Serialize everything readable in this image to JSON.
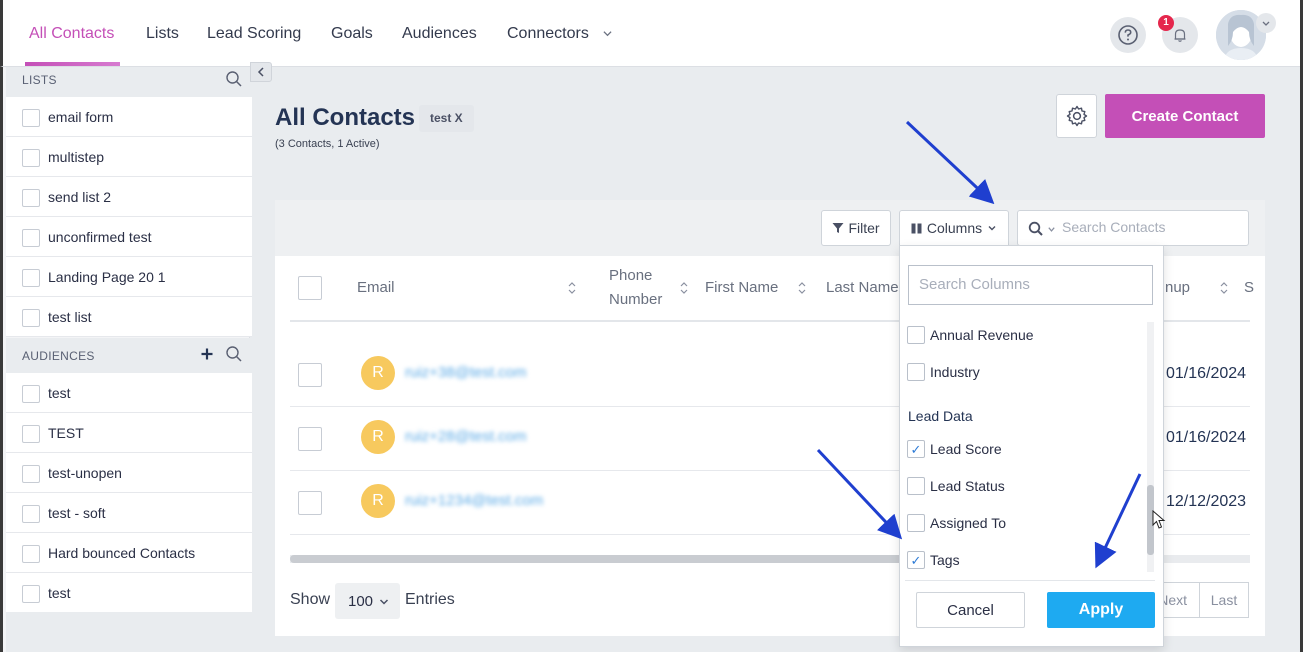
{
  "colors": {
    "accent": "#c44fb7",
    "apply": "#1eaaf1",
    "avatar": "#f7c95e",
    "badge": "#e5274d",
    "arrow": "#1f3fcf",
    "link": "#5aa9e6"
  },
  "nav": {
    "items": [
      "All Contacts",
      "Lists",
      "Lead Scoring",
      "Goals",
      "Audiences",
      "Connectors"
    ],
    "active": "All Contacts",
    "notification_count": "1"
  },
  "sidebar": {
    "lists_heading": "LISTS",
    "lists": [
      "email form",
      "multistep",
      "send list 2",
      "unconfirmed test",
      "Landing Page 20 1",
      "test list"
    ],
    "audiences_heading": "AUDIENCES",
    "audiences": [
      "test",
      "TEST",
      "test-unopen",
      "test - soft",
      "Hard bounced Contacts",
      "test"
    ]
  },
  "page": {
    "title": "All Contacts",
    "filter_chip": "test X",
    "subtitle": "(3 Contacts, 1 Active)",
    "create_label": "Create Contact"
  },
  "toolbar": {
    "filter_label": "Filter",
    "columns_label": "Columns",
    "search_placeholder": "Search Contacts"
  },
  "table": {
    "columns": [
      "Email",
      "Phone",
      "Number",
      "First Name",
      "Last Name",
      "nup",
      "S"
    ],
    "rows": [
      {
        "initial": "R",
        "email": "ruiz+38@test.com",
        "date": "01/16/2024"
      },
      {
        "initial": "R",
        "email": "ruiz+28@test.com",
        "date": "01/16/2024"
      },
      {
        "initial": "R",
        "email": "ruiz+1234@test.com",
        "date": "12/12/2023"
      }
    ]
  },
  "footer": {
    "show_label": "Show",
    "entries_value": "100",
    "entries_label": "Entries",
    "next_label": "Next",
    "last_label": "Last"
  },
  "columns_dropdown": {
    "search_placeholder": "Search Columns",
    "items_top": [
      {
        "label": "Annual Revenue",
        "checked": false
      },
      {
        "label": "Industry",
        "checked": false
      }
    ],
    "group_label": "Lead Data",
    "items_group": [
      {
        "label": "Lead Score",
        "checked": true
      },
      {
        "label": "Lead Status",
        "checked": false
      },
      {
        "label": "Assigned To",
        "checked": false
      },
      {
        "label": "Tags",
        "checked": true
      }
    ],
    "cancel_label": "Cancel",
    "apply_label": "Apply",
    "check_glyph": "✓"
  }
}
